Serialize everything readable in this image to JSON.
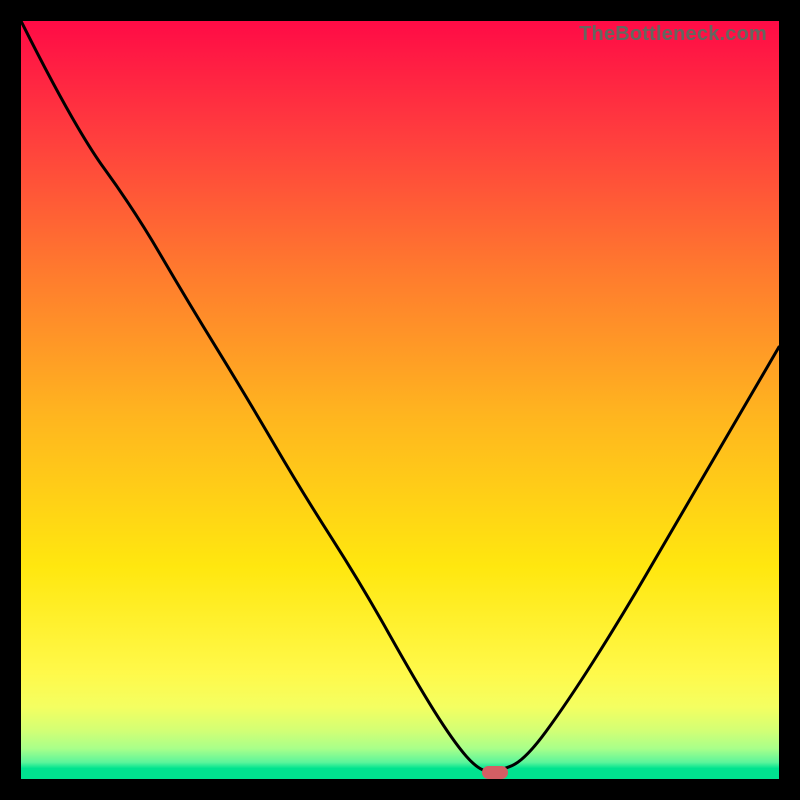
{
  "watermark": "TheBottleneck.com",
  "chart_data": {
    "type": "line",
    "title": "",
    "xlabel": "",
    "ylabel": "",
    "xlim": [
      0,
      1
    ],
    "ylim": [
      0,
      1
    ],
    "series": [
      {
        "name": "curve",
        "x": [
          0.0,
          0.07,
          0.15,
          0.22,
          0.3,
          0.37,
          0.45,
          0.52,
          0.57,
          0.605,
          0.63,
          0.665,
          0.72,
          0.79,
          0.86,
          0.93,
          1.0
        ],
        "y": [
          1.0,
          0.86,
          0.75,
          0.63,
          0.5,
          0.38,
          0.255,
          0.13,
          0.05,
          0.01,
          0.01,
          0.025,
          0.1,
          0.21,
          0.33,
          0.45,
          0.57
        ]
      }
    ],
    "marker": {
      "x": 0.625,
      "y": 0.005
    },
    "background_gradient": {
      "stops": [
        {
          "pos": 0.0,
          "color": "#ff0b46"
        },
        {
          "pos": 0.15,
          "color": "#ff3d3e"
        },
        {
          "pos": 0.33,
          "color": "#ff7a2e"
        },
        {
          "pos": 0.52,
          "color": "#ffb51f"
        },
        {
          "pos": 0.72,
          "color": "#ffe70f"
        },
        {
          "pos": 0.86,
          "color": "#fff94a"
        },
        {
          "pos": 0.905,
          "color": "#f4ff61"
        },
        {
          "pos": 0.935,
          "color": "#d4ff74"
        },
        {
          "pos": 0.96,
          "color": "#a8ff8a"
        },
        {
          "pos": 0.978,
          "color": "#5cf59b"
        },
        {
          "pos": 0.986,
          "color": "#00e38f"
        },
        {
          "pos": 1.0,
          "color": "#00e38f"
        }
      ]
    }
  }
}
